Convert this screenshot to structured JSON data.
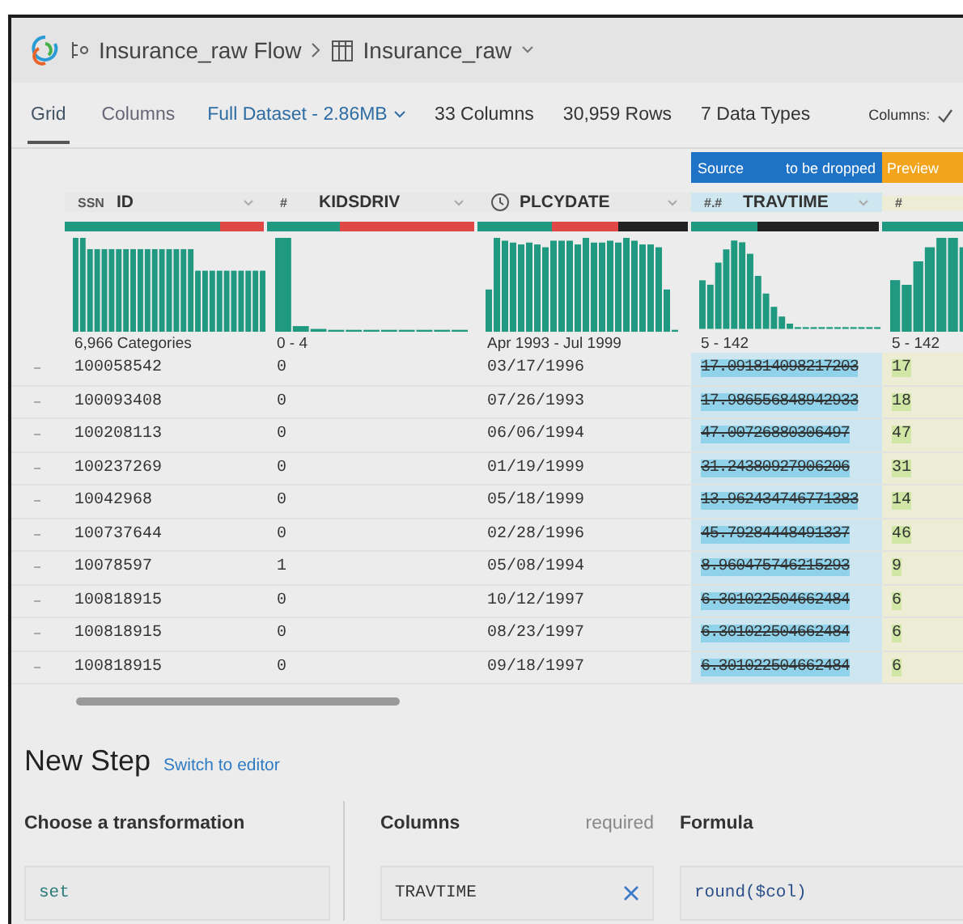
{
  "header": {
    "flow": "Insurance_raw Flow",
    "dataset": "Insurance_raw"
  },
  "tabs": [
    {
      "label": "Grid",
      "selected": true
    },
    {
      "label": "Columns",
      "selected": false
    }
  ],
  "dataset_menu": "Full Dataset - 2.86MB",
  "stats": [
    "33 Columns",
    "30,959 Rows",
    "7 Data Types"
  ],
  "columns_toggle": "Columns:",
  "band": {
    "source": "Source",
    "dropped": "to be dropped",
    "preview": "Preview"
  },
  "columns": [
    {
      "kind": "text",
      "type": "SSN",
      "name": "ID",
      "dropped": false,
      "preview": false,
      "summary": "6,966 Categories"
    },
    {
      "kind": "text",
      "type": "#",
      "name": "KIDSDRIV",
      "dropped": false,
      "preview": false,
      "summary": "0 - 4"
    },
    {
      "kind": "clock",
      "name": "PLCYDATE",
      "dropped": false,
      "preview": false,
      "summary": "Apr 1993 - Jul 1999"
    },
    {
      "kind": "text",
      "type": "#.#",
      "name": "TRAVTIME",
      "dropped": true,
      "preview": false,
      "summary": "5 - 142"
    },
    {
      "kind": "text",
      "type": "#",
      "dropped": false,
      "preview": true,
      "summary": "5 - 142"
    }
  ],
  "rows": [
    {
      "cells": [
        "100058542",
        "0",
        "03/17/1996",
        "17.091814098217203",
        "17"
      ]
    },
    {
      "cells": [
        "100093408",
        "0",
        "07/26/1993",
        "17.986556848942933",
        "18"
      ]
    },
    {
      "cells": [
        "100208113",
        "0",
        "06/06/1994",
        "47.00726880306497",
        "47"
      ]
    },
    {
      "cells": [
        "100237269",
        "0",
        "01/19/1999",
        "31.24380927906206",
        "31"
      ]
    },
    {
      "cells": [
        "10042968",
        "0",
        "05/18/1999",
        "13.962434746771383",
        "14"
      ]
    },
    {
      "cells": [
        "100737644",
        "0",
        "02/28/1996",
        "45.79284448491337",
        "46"
      ]
    },
    {
      "cells": [
        "10078597",
        "1",
        "05/08/1994",
        "8.960475746215293",
        "9"
      ]
    },
    {
      "cells": [
        "100818915",
        "0",
        "10/12/1997",
        "6.301022504662484",
        "6"
      ]
    },
    {
      "cells": [
        "100818915",
        "0",
        "08/23/1997",
        "6.301022504662484",
        "6"
      ]
    },
    {
      "cells": [
        "100818915",
        "0",
        "09/18/1997",
        "6.301022504662484",
        "6"
      ]
    }
  ],
  "new_step": {
    "title": "New Step",
    "link": "Switch to editor"
  },
  "form": {
    "transformation": {
      "label": "Choose a transformation",
      "value": "set"
    },
    "columns": {
      "label": "Columns",
      "hint": "required",
      "value": "TRAVTIME"
    },
    "formula": {
      "label": "Formula",
      "value": "round($col)"
    }
  }
}
